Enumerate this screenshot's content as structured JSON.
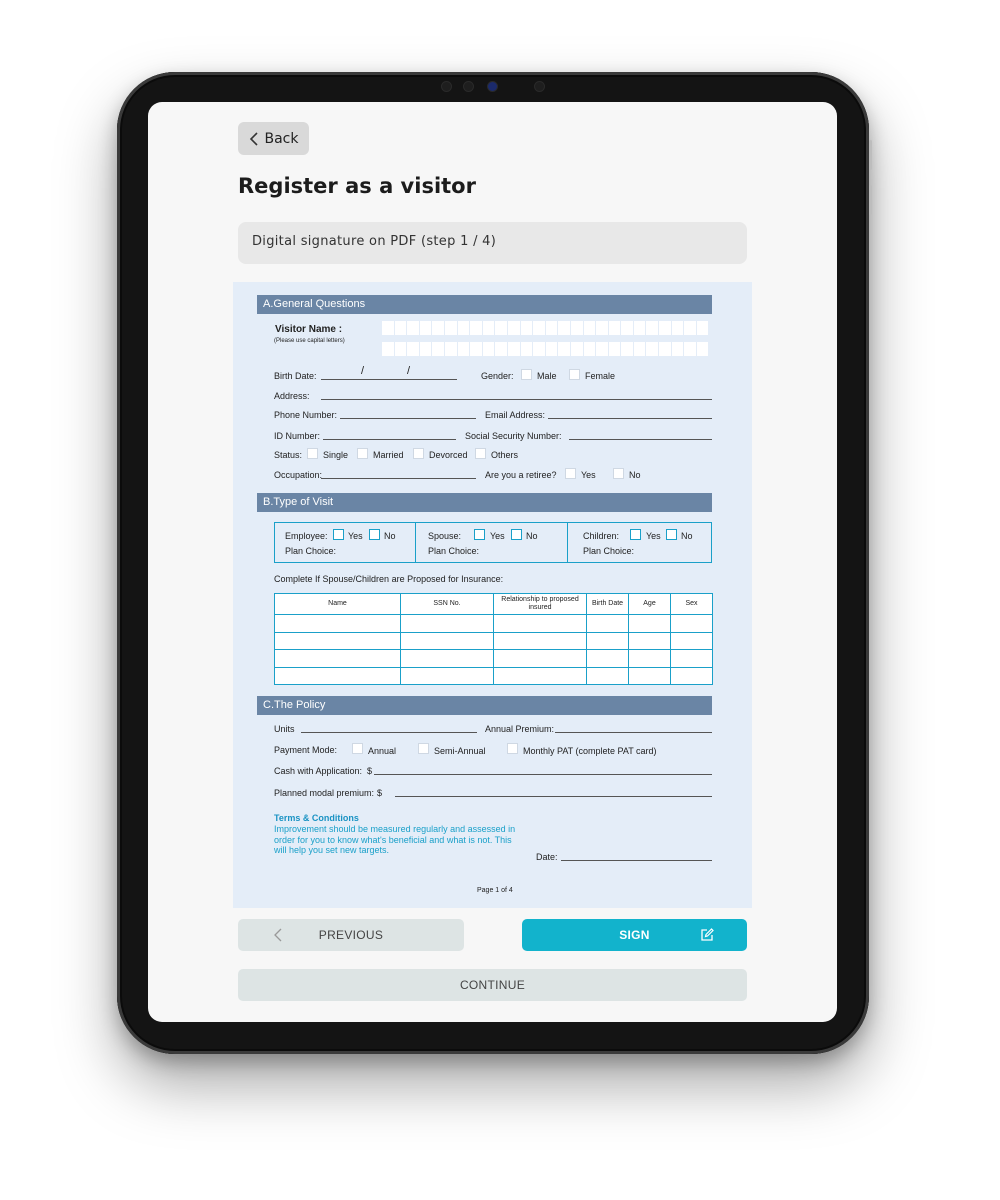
{
  "header": {
    "back_label": "Back",
    "title": "Register as a visitor",
    "step_text": "Digital signature on PDF (step 1 / 4)"
  },
  "form": {
    "section_a": {
      "title": "A.General Questions",
      "visitor_name_label": "Visitor Name :",
      "visitor_name_hint": "(Please use capital letters)",
      "birth_date_label": "Birth Date:",
      "date_separator": "/",
      "gender_label": "Gender:",
      "gender_male": "Male",
      "gender_female": "Female",
      "address_label": "Address:",
      "phone_label": "Phone Number:",
      "email_label": "Email Address:",
      "id_label": "ID Number:",
      "ssn_label": "Social Security  Number:",
      "status_label": "Status:",
      "status_single": "Single",
      "status_married": "Married",
      "status_divorced": "Devorced",
      "status_others": "Others",
      "occupation_label": "Occupation:",
      "retiree_label": "Are you a retiree?",
      "retiree_yes": "Yes",
      "retiree_no": "No"
    },
    "section_b": {
      "title": "B.Type of Visit",
      "employee_label": "Employee:",
      "spouse_label": "Spouse:",
      "children_label": "Children:",
      "yes": "Yes",
      "no": "No",
      "plan_choice": "Plan Choice:",
      "complete_note": "Complete If Spouse/Children are Proposed for Insurance:",
      "table_headers": [
        "Name",
        "SSN No.",
        "Relationship to proposed insured",
        "Birth Date",
        "Age",
        "Sex"
      ]
    },
    "section_c": {
      "title": "C.The Policy",
      "units_label": "Units",
      "annual_premium_label": "Annual Premium:",
      "payment_mode_label": "Payment Mode:",
      "pm_annual": "Annual",
      "pm_semi": "Semi-Annual",
      "pm_monthly": "Monthly PAT (complete PAT card)",
      "cash_label": "Cash with Application:",
      "planned_label": "Planned modal premium:",
      "currency": "$",
      "terms_title": "Terms & Conditions",
      "terms_body": "Improvement should be measured regularly and assessed in order for you to know what's beneficial and what is not. This will help you set new targets.",
      "date_label": "Date:",
      "page_number": "Page 1 of 4"
    }
  },
  "actions": {
    "previous_label": "PREVIOUS",
    "sign_label": "SIGN",
    "continue_label": "CONTINUE"
  },
  "colors": {
    "section_header": "#6a85a5",
    "document_bg": "#e4edf8",
    "accent_cyan": "#12b3cc",
    "table_border": "#1aa0c9"
  }
}
